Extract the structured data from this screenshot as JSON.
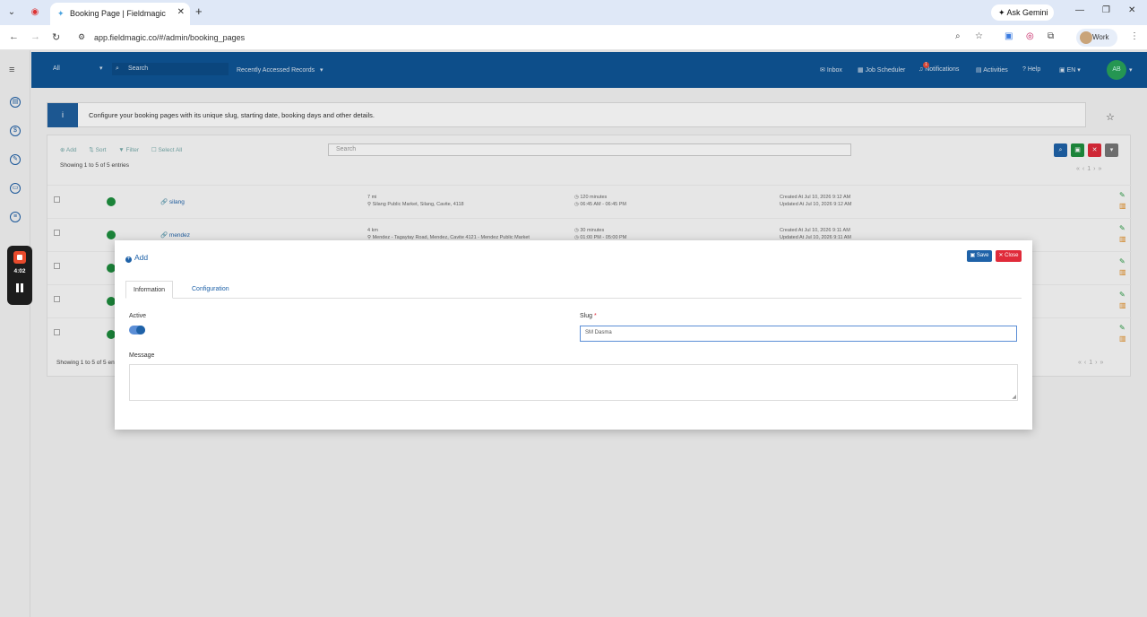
{
  "browser": {
    "tab_title": "Booking Page | Fieldmagic",
    "url": "app.fieldmagic.co/#/admin/booking_pages",
    "gemini_label": "Ask Gemini",
    "profile_label": "Work"
  },
  "topnav": {
    "filter_value": "All",
    "search_placeholder": "Search",
    "recent_label": "Recently Accessed Records",
    "inbox": "Inbox",
    "job_scheduler": "Job Scheduler",
    "notifications": "Notifications",
    "notification_count": "1",
    "activities": "Activities",
    "help": "Help",
    "language": "EN",
    "avatar_initials": "AB"
  },
  "info": {
    "text": "Configure your booking pages with its unique slug, starting date, booking days and other details."
  },
  "list": {
    "toolbar": {
      "add": "Add",
      "sort": "Sort",
      "filter": "Filter",
      "select_all": "Select All"
    },
    "search_placeholder": "Search",
    "showing": "Showing 1 to 5 of 5 entries",
    "rows": [
      {
        "slug": "silang",
        "line1": "7 mi",
        "line2": "Silang Public Market, Silang, Cavite, 4118",
        "dur1": "120 minutes",
        "dur2": "06:45 AM - 06:45 PM",
        "created": "Created At Jul 10, 2026 9:12 AM",
        "updated": "Updated At Jul 10, 2026 9:12 AM"
      },
      {
        "slug": "mendez",
        "line1": "4 km",
        "line2": "Mendez - Tagaytay Road, Mendez, Cavite 4121 - Mendez Public Market",
        "dur1": "30 minutes",
        "dur2": "01:00 PM - 05:00 PM",
        "created": "Created At Jul 10, 2026 9:11 AM",
        "updated": "Updated At Jul 10, 2026 9:11 AM"
      },
      {
        "slug": "",
        "line1": "",
        "line2": "",
        "dur1": "",
        "dur2": "",
        "created": "",
        "updated": ""
      },
      {
        "slug": "",
        "line1": "",
        "line2": "",
        "dur1": "",
        "dur2": "",
        "created": "",
        "updated": ""
      },
      {
        "slug": "",
        "line1": "",
        "line2": "",
        "dur1": "",
        "dur2": "",
        "created": "",
        "updated": ""
      }
    ]
  },
  "modal": {
    "title": "Add",
    "save": "Save",
    "close": "Close",
    "tabs": [
      "Information",
      "Configuration"
    ],
    "active_label": "Active",
    "active_value": true,
    "slug_label": "Slug",
    "slug_required": "*",
    "slug_value": "SM Dasma",
    "message_label": "Message",
    "message_value": ""
  },
  "recorder": {
    "time": "4:02"
  },
  "colors": {
    "brand_nav": "#0f5596",
    "primary": "#1f62a8",
    "danger": "#e02b3a",
    "success": "#1e8f3e"
  }
}
